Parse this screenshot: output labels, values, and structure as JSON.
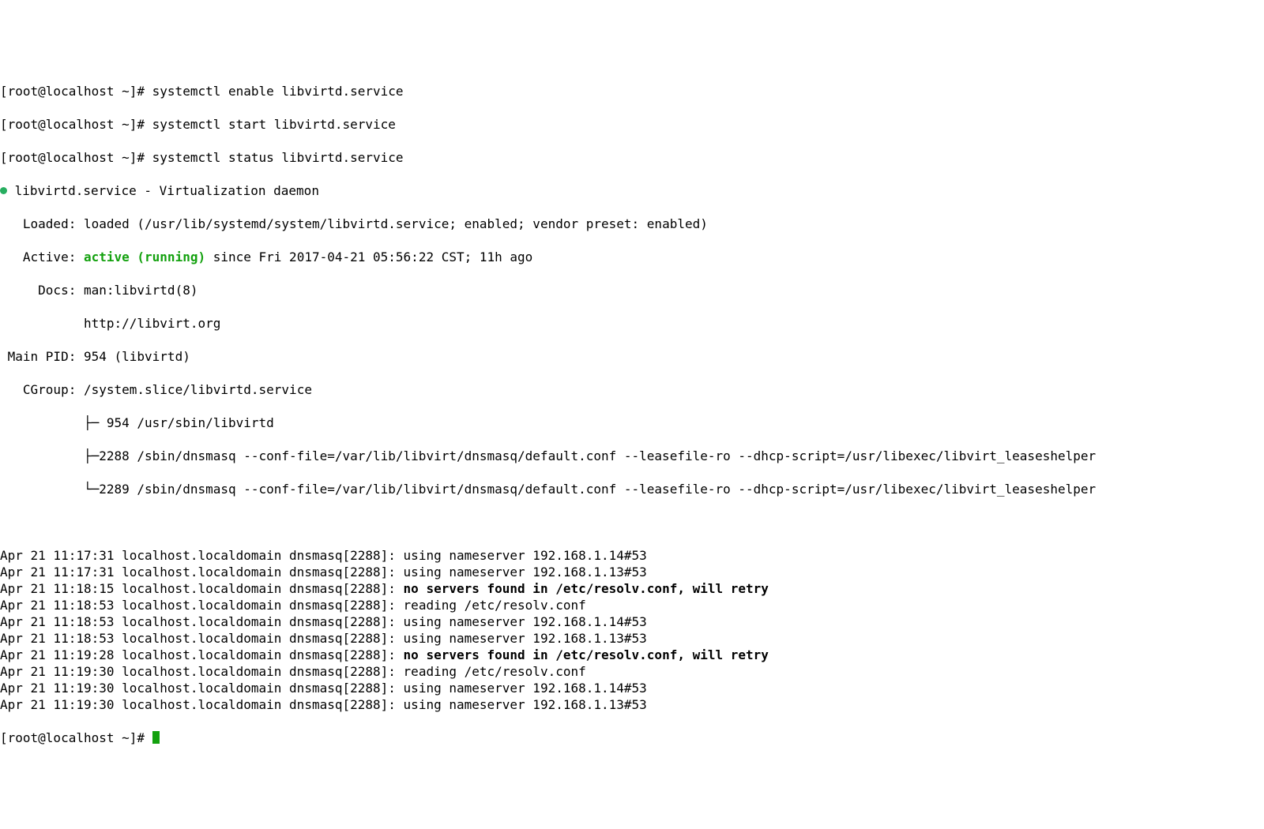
{
  "prompt1": {
    "user_host_dir": "[root@localhost ~]# ",
    "cmd": "systemctl enable libvirtd.service"
  },
  "prompt2": {
    "user_host_dir": "[root@localhost ~]# ",
    "cmd": "systemctl start libvirtd.service"
  },
  "prompt3": {
    "user_host_dir": "[root@localhost ~]# ",
    "cmd": "systemctl status libvirtd.service"
  },
  "status": {
    "unit_line": " libvirtd.service - Virtualization daemon",
    "loaded_label": "   Loaded: ",
    "loaded_value": "loaded (/usr/lib/systemd/system/libvirtd.service; enabled; vendor preset: enabled)",
    "active_label": "   Active: ",
    "active_value": "active (running)",
    "active_since": " since Fri 2017-04-21 05:56:22 CST; 11h ago",
    "docs_label": "     Docs: ",
    "docs_value1": "man:libvirtd(8)",
    "docs_indent": "           ",
    "docs_value2": "http://libvirt.org",
    "mainpid_label": " Main PID: ",
    "mainpid_value": "954 (libvirtd)",
    "cgroup_label": "   CGroup: ",
    "cgroup_value": "/system.slice/libvirtd.service",
    "tree1": "           ├─ 954 /usr/sbin/libvirtd",
    "tree2": "           ├─2288 /sbin/dnsmasq --conf-file=/var/lib/libvirt/dnsmasq/default.conf --leasefile-ro --dhcp-script=/usr/libexec/libvirt_leaseshelper",
    "tree3": "           └─2289 /sbin/dnsmasq --conf-file=/var/lib/libvirt/dnsmasq/default.conf --leasefile-ro --dhcp-script=/usr/libexec/libvirt_leaseshelper"
  },
  "logs": [
    {
      "prefix": "Apr 21 11:17:31 localhost.localdomain dnsmasq[2288]: ",
      "msg": "using nameserver 192.168.1.14#53",
      "bold": false
    },
    {
      "prefix": "Apr 21 11:17:31 localhost.localdomain dnsmasq[2288]: ",
      "msg": "using nameserver 192.168.1.13#53",
      "bold": false
    },
    {
      "prefix": "Apr 21 11:18:15 localhost.localdomain dnsmasq[2288]: ",
      "msg": "no servers found in /etc/resolv.conf, will retry",
      "bold": true
    },
    {
      "prefix": "Apr 21 11:18:53 localhost.localdomain dnsmasq[2288]: ",
      "msg": "reading /etc/resolv.conf",
      "bold": false
    },
    {
      "prefix": "Apr 21 11:18:53 localhost.localdomain dnsmasq[2288]: ",
      "msg": "using nameserver 192.168.1.14#53",
      "bold": false
    },
    {
      "prefix": "Apr 21 11:18:53 localhost.localdomain dnsmasq[2288]: ",
      "msg": "using nameserver 192.168.1.13#53",
      "bold": false
    },
    {
      "prefix": "Apr 21 11:19:28 localhost.localdomain dnsmasq[2288]: ",
      "msg": "no servers found in /etc/resolv.conf, will retry",
      "bold": true
    },
    {
      "prefix": "Apr 21 11:19:30 localhost.localdomain dnsmasq[2288]: ",
      "msg": "reading /etc/resolv.conf",
      "bold": false
    },
    {
      "prefix": "Apr 21 11:19:30 localhost.localdomain dnsmasq[2288]: ",
      "msg": "using nameserver 192.168.1.14#53",
      "bold": false
    },
    {
      "prefix": "Apr 21 11:19:30 localhost.localdomain dnsmasq[2288]: ",
      "msg": "using nameserver 192.168.1.13#53",
      "bold": false
    }
  ],
  "prompt4": {
    "user_host_dir": "[root@localhost ~]# "
  },
  "colors": {
    "active_green": "#13a10e",
    "dot_green": "#27ae60"
  }
}
